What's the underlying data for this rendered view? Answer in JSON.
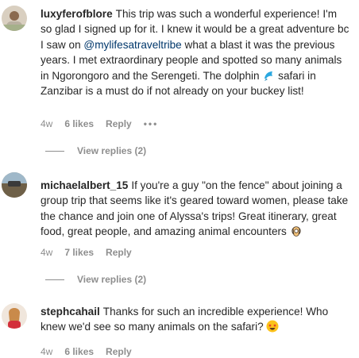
{
  "comments": [
    {
      "username": "luxyferofblore",
      "text_before_mention": "This trip was such a wonderful experience! I'm so glad I signed up for it. I knew it would be a great adventure bc I saw on ",
      "mention": "@mylifesatraveltribe",
      "text_after_mention": " what a blast it was the previous years. I met extraordinary people and spotted so many animals in Ngorongoro and the Serengeti. The dolphin ",
      "emoji": "dolphin-emoji",
      "text_after_emoji": " safari in Zanzibar is a must do if not already on your buckey list!",
      "age": "4w",
      "likes": "6 likes",
      "reply": "Reply",
      "more": "•••",
      "view_replies": "View replies (2)"
    },
    {
      "username": "michaelalbert_15",
      "text": "If you're a guy \"on the fence\" about joining a group trip that seems like it's geared toward women, please take the chance and join one of Alyssa's trips! Great itinerary, great food, great people, and amazing animal encounters ",
      "emoji": "ok-hand-emoji",
      "age": "4w",
      "likes": "7 likes",
      "reply": "Reply",
      "view_replies": "View replies (2)"
    },
    {
      "username": "stephcahail",
      "text": "Thanks for such an incredible experience! Who knew we'd see so many animals on the safari? ",
      "emoji": "star-struck-emoji",
      "age": "4w",
      "likes": "6 likes",
      "reply": "Reply"
    }
  ],
  "colors": {
    "text": "#262626",
    "secondary": "#8e8e8e",
    "mention": "#00376b"
  }
}
